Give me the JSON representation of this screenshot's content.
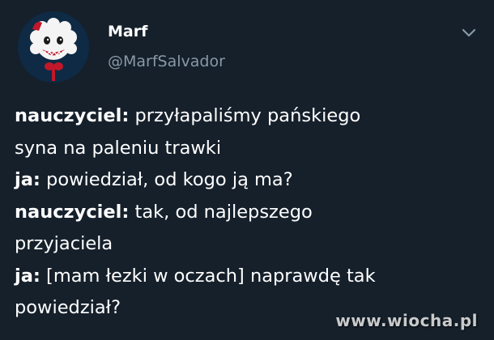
{
  "author": {
    "name": "Marf",
    "handle": "@MarfSalvador"
  },
  "icons": {
    "menu": "chevron-down-icon",
    "avatar": "clown-avatar"
  },
  "tweet": {
    "lines": [
      {
        "speaker": "nauczyciel:",
        "text": " przyłapaliśmy pańskiego"
      },
      {
        "speaker": "",
        "text": "syna na paleniu trawki"
      },
      {
        "speaker": "ja:",
        "text": " powiedział, od kogo ją ma?"
      },
      {
        "speaker": "nauczyciel:",
        "text": " tak, od najlepszego"
      },
      {
        "speaker": "",
        "text": "przyjaciela"
      },
      {
        "speaker": "ja:",
        "text": " [mam łezki w oczach] naprawdę tak"
      },
      {
        "speaker": "",
        "text": "powiedział?"
      }
    ]
  },
  "watermark": "www.wiocha.pl",
  "colors": {
    "background": "#15202b",
    "text": "#ffffff",
    "secondary": "#8899a6"
  }
}
